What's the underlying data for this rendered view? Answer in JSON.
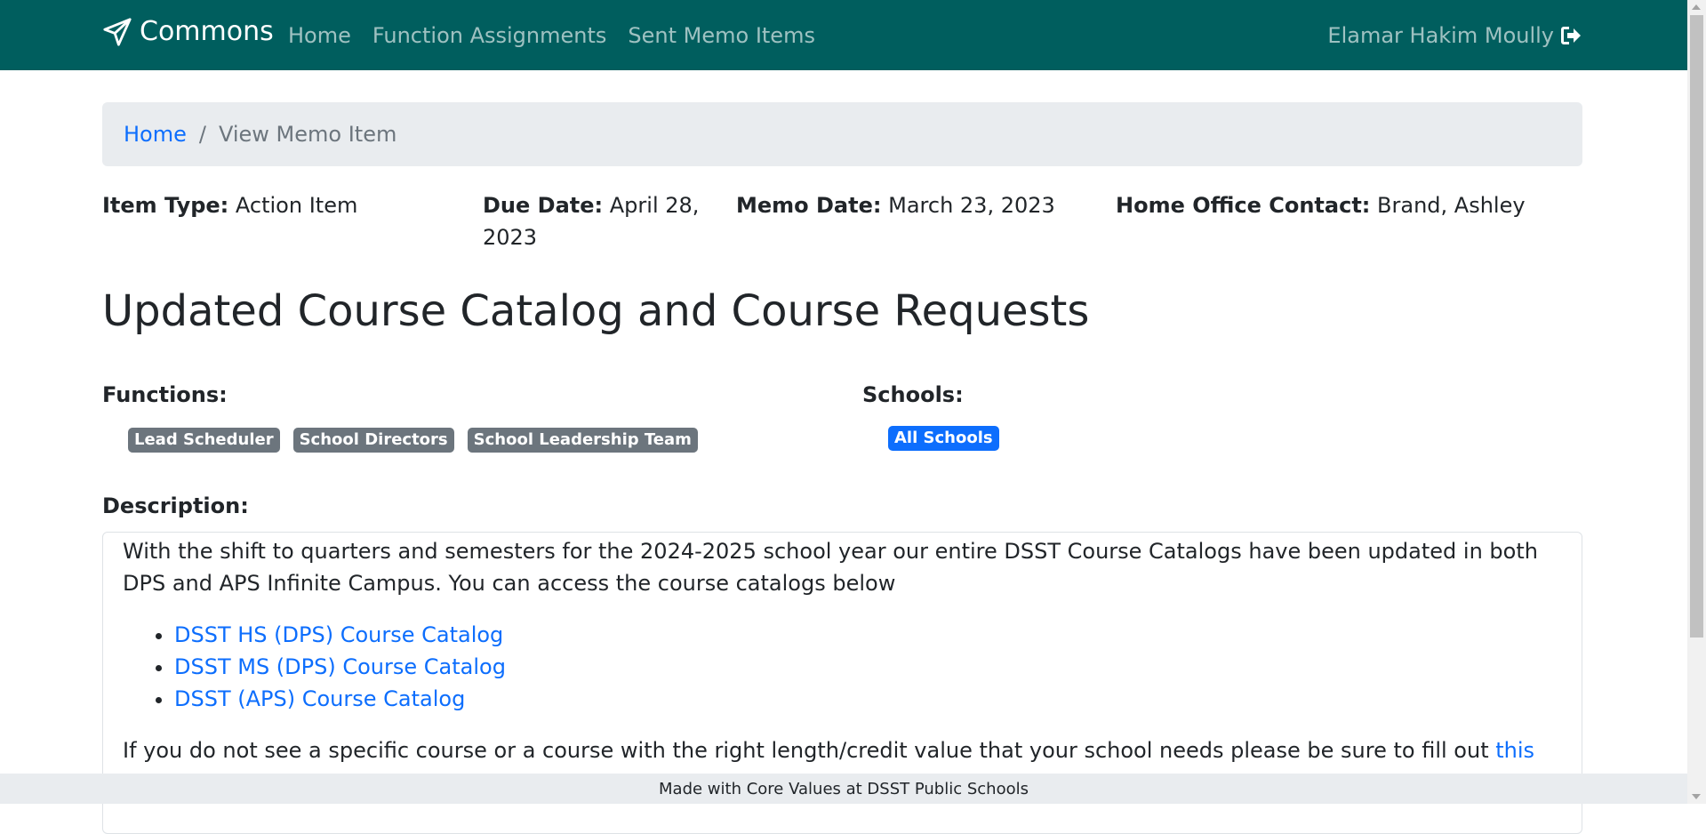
{
  "navbar": {
    "brand": "Commons",
    "links": [
      "Home",
      "Function Assignments",
      "Sent Memo Items"
    ],
    "user": "Elamar Hakim Moully",
    "bg_color": "#005e5e"
  },
  "breadcrumb": {
    "home": "Home",
    "separator": "/",
    "current": "View Memo Item"
  },
  "meta": {
    "item_type_label": "Item Type:",
    "item_type": "Action Item",
    "due_date_label": "Due Date:",
    "due_date_1": "April 28,",
    "due_date_2": "2023",
    "memo_date_label": "Memo Date:",
    "memo_date": "March 23, 2023",
    "contact_label": "Home Office Contact:",
    "contact": "Brand, Ashley"
  },
  "title": "Updated Course Catalog and Course Requests",
  "functions": {
    "label": "Functions:",
    "badges": [
      "Lead Scheduler",
      "School Directors",
      "School Leadership Team"
    ]
  },
  "schools": {
    "label": "Schools:",
    "badges": [
      "All Schools"
    ]
  },
  "description": {
    "label": "Description:",
    "intro": "With the shift to quarters and semesters for the 2024-2025 school year our entire DSST Course Catalogs have been updated in both DPS and APS Infinite Campus. You can access the course catalogs below",
    "links": [
      "DSST HS (DPS) Course Catalog",
      "DSST MS (DPS) Course Catalog",
      "DSST (APS) Course Catalog"
    ],
    "outro_text": "If you do not see a specific course or a course with the right length/credit value that your school needs please be sure to fill out ",
    "outro_link": "this DSST Course"
  },
  "footer": "Made with Core Values at DSST Public Schools",
  "colors": {
    "link": "#0d6efd",
    "badge_gray": "#6c757d",
    "badge_blue": "#0d6efd"
  }
}
